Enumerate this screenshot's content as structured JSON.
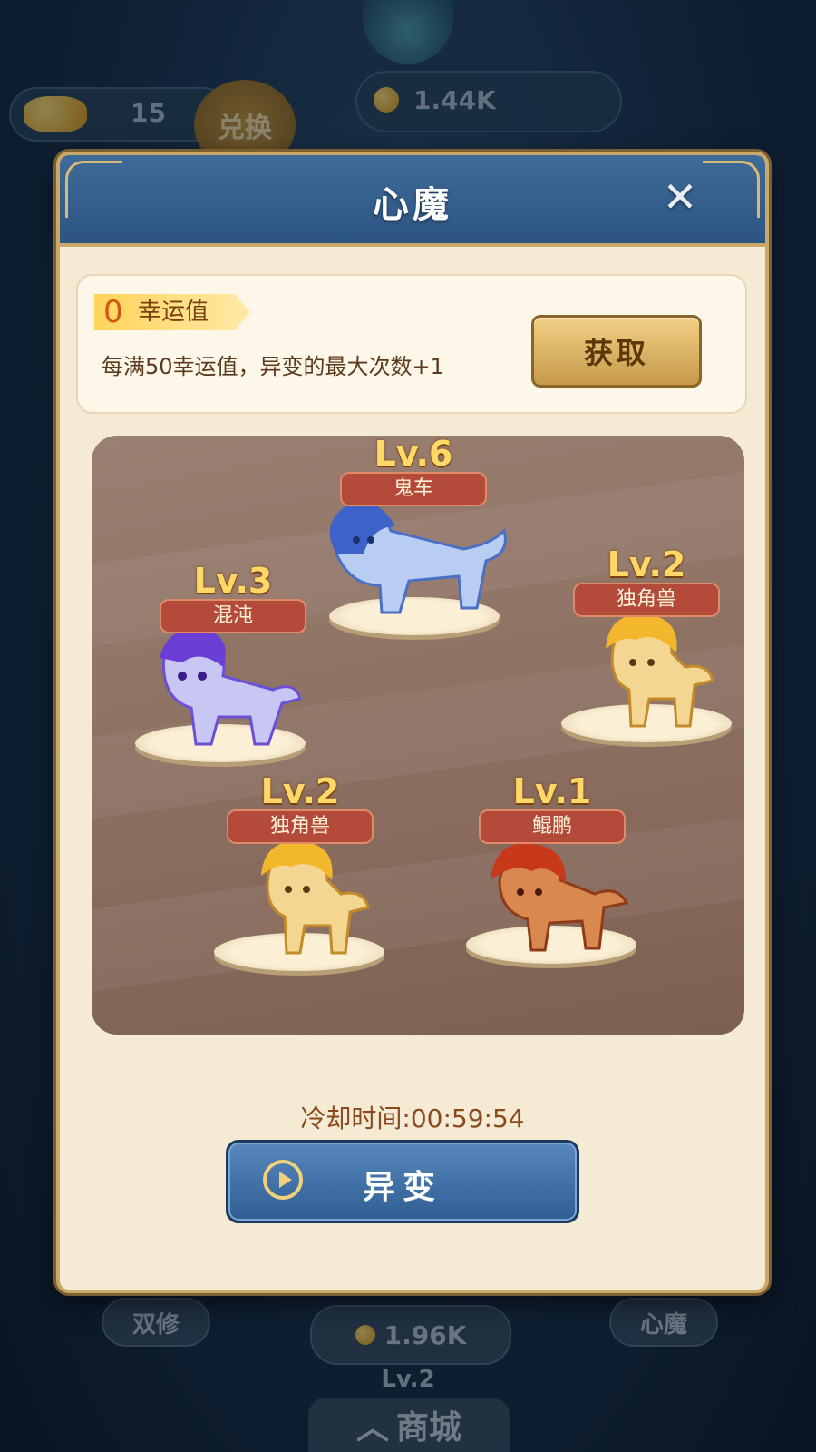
{
  "hud": {
    "gold_count": "15",
    "exchange_label": "兑换",
    "currency_amount": "1.44K",
    "bottom_amount": "1.96K",
    "bottom_level": "Lv.2",
    "shop_label": "商城",
    "left_tab_label": "双修",
    "right_tab_label": "心魔"
  },
  "modal": {
    "title": "心魔",
    "close_icon": "close-icon",
    "luck": {
      "value": "0",
      "label": "幸运值",
      "description": "每满50幸运值，异变的最大次数+1",
      "get_button": "获取"
    },
    "monsters": [
      {
        "level": "Lv.6",
        "name": "鬼车",
        "color": "#7f9fe0"
      },
      {
        "level": "Lv.3",
        "name": "混沌",
        "color": "#8f7fe8"
      },
      {
        "level": "Lv.2",
        "name": "独角兽",
        "color": "#f2c44f"
      },
      {
        "level": "Lv.2",
        "name": "独角兽",
        "color": "#f2c44f"
      },
      {
        "level": "Lv.1",
        "name": "鲲鹏",
        "color": "#c8492c"
      }
    ],
    "cooldown": "冷却时间:00:59:54",
    "mutate_button": "异变"
  }
}
